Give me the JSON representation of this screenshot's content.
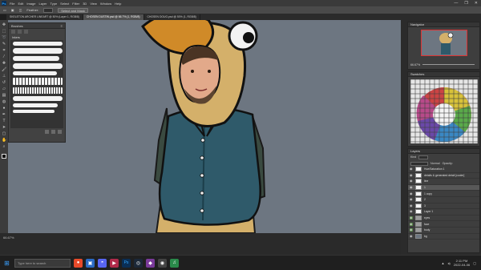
{
  "menu": {
    "items": [
      "File",
      "Edit",
      "Image",
      "Layer",
      "Type",
      "Select",
      "Filter",
      "3D",
      "View",
      "Window",
      "Help"
    ],
    "window_controls": [
      "—",
      "❐",
      "✕"
    ]
  },
  "options": {
    "share_label": "Select and Mask",
    "feather_label": "Feather:"
  },
  "tabs": [
    {
      "label": "SKELETON ARCHER LINEART @ 50% (Layer 1, RGB/8)",
      "active": false
    },
    {
      "label": "CHOSEN DUSTIN.psd @ 66.7% (1, RGB/8)",
      "active": true
    },
    {
      "label": "CHOSEN DOUG.psd @ 50% (1, RGB/8)",
      "active": false
    }
  ],
  "toolbar": {
    "icons": [
      "move-icon",
      "marquee-icon",
      "lasso-icon",
      "quick-select-icon",
      "crop-icon",
      "eyedropper-icon",
      "healing-icon",
      "brush-icon",
      "stamp-icon",
      "history-brush-icon",
      "eraser-icon",
      "gradient-icon",
      "blur-icon",
      "dodge-icon",
      "pen-icon",
      "type-icon",
      "path-select-icon",
      "shape-icon",
      "hand-icon",
      "zoom-icon"
    ]
  },
  "brushes_panel": {
    "title": "Brushes",
    "group": "Inkers",
    "stroke_count": 10
  },
  "navigator": {
    "title": "Navigator",
    "zoom": "66.67%"
  },
  "swatches_panel": {
    "title": "Swatches"
  },
  "layers_panel": {
    "title": "Layers",
    "kind_label": "Kind",
    "blend_label": "Normal",
    "opacity_label": "Opacity:",
    "layers": [
      {
        "name": "Hue/Saturation 1",
        "type": "adjust",
        "selected": false,
        "green": false
      },
      {
        "name": "details & generated detail [cooler]",
        "type": "layer",
        "selected": false,
        "green": false
      },
      {
        "name": "line",
        "type": "layer",
        "selected": false,
        "green": false
      },
      {
        "name": "1",
        "type": "layer",
        "selected": true,
        "green": false
      },
      {
        "name": "1 copy",
        "type": "layer",
        "selected": false,
        "green": false
      },
      {
        "name": "2",
        "type": "layer",
        "selected": false,
        "green": false
      },
      {
        "name": "3",
        "type": "layer",
        "selected": false,
        "green": false
      },
      {
        "name": "Layer 1",
        "type": "layer",
        "selected": false,
        "green": false
      },
      {
        "name": "eyes",
        "type": "folder",
        "selected": false,
        "green": true
      },
      {
        "name": "face",
        "type": "folder",
        "selected": false,
        "green": true
      },
      {
        "name": "body",
        "type": "folder",
        "selected": false,
        "green": true
      },
      {
        "name": "bg",
        "type": "layer",
        "selected": false,
        "green": false
      }
    ]
  },
  "status": {
    "zoom": "66.67%"
  },
  "taskbar": {
    "search_placeholder": "Type here to search",
    "time": "2:11 PM",
    "date": "2022-04-06"
  },
  "colors": {
    "canvas_bg": "#6d7681",
    "vest": "#2f5a6a",
    "costume_yellow": "#d4b06a",
    "accent": "#31a8ff"
  }
}
